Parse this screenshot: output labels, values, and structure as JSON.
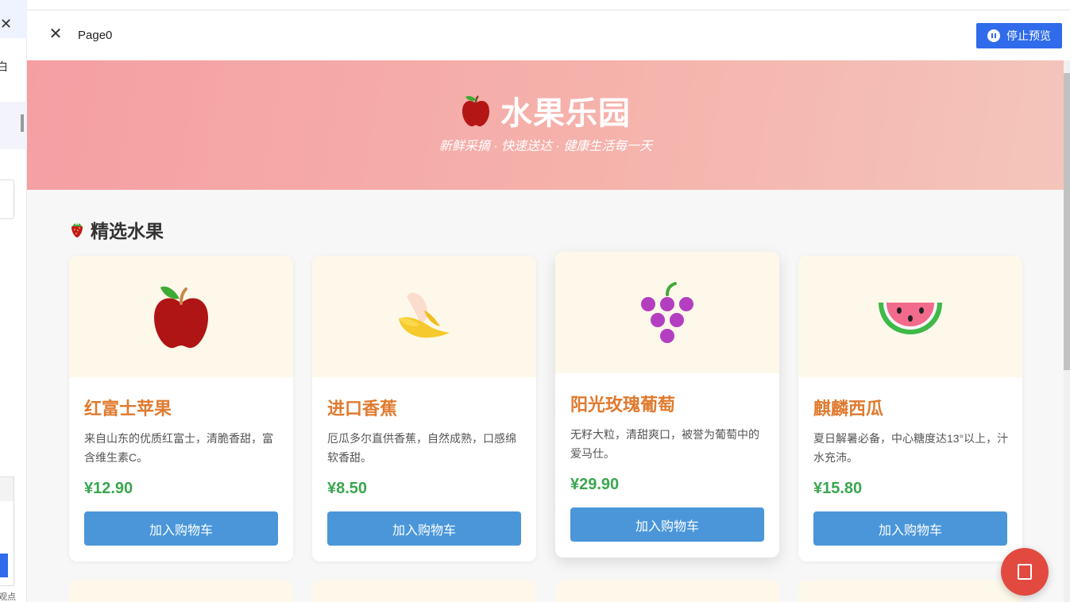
{
  "window": {
    "page_name": "Page0",
    "stop_preview_label": "停止预览",
    "background_snippets": {
      "side_char": "白",
      "bottom_text": "观点"
    }
  },
  "hero": {
    "title": "水果乐园",
    "subtitle": "新鲜采摘 · 快速送达 · 健康生活每一天"
  },
  "section": {
    "title": "精选水果"
  },
  "products": [
    {
      "icon": "apple-icon",
      "name": "红富士苹果",
      "description": "来自山东的优质红富士，清脆香甜，富含维生素C。",
      "price": "¥12.90",
      "button": "加入购物车"
    },
    {
      "icon": "banana-icon",
      "name": "进口香蕉",
      "description": "厄瓜多尔直供香蕉，自然成熟，口感绵软香甜。",
      "price": "¥8.50",
      "button": "加入购物车"
    },
    {
      "icon": "grapes-icon",
      "name": "阳光玫瑰葡萄",
      "description": "无籽大粒，清甜爽口，被誉为葡萄中的爱马仕。",
      "price": "¥29.90",
      "button": "加入购物车"
    },
    {
      "icon": "watermelon-icon",
      "name": "麒麟西瓜",
      "description": "夏日解暑必备，中心糖度达13°以上，汁水充沛。",
      "price": "¥15.80",
      "button": "加入购物车"
    }
  ],
  "colors": {
    "accent_blue": "#2f6bea",
    "product_name": "#e07a2e",
    "price_green": "#3aa64f",
    "cart_button": "#4a96d9",
    "fab_red": "#e24a40"
  }
}
